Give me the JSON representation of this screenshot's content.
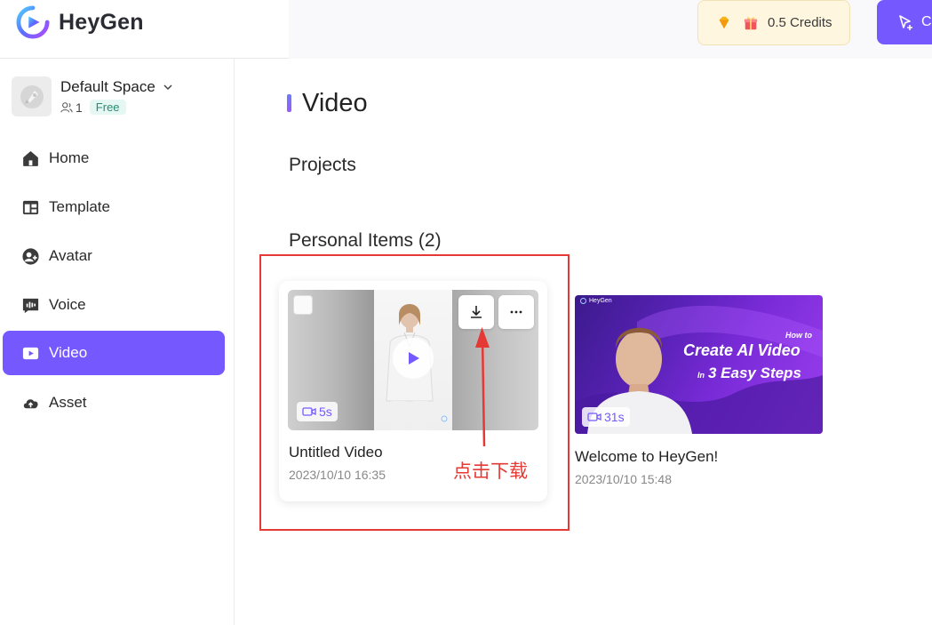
{
  "header": {
    "brand": "HeyGen",
    "credits_label": "0.5 Credits",
    "create_label": "C"
  },
  "sidebar": {
    "space": {
      "name": "Default Space",
      "members": "1",
      "plan": "Free"
    },
    "items": [
      {
        "label": "Home",
        "icon": "home-icon"
      },
      {
        "label": "Template",
        "icon": "template-icon"
      },
      {
        "label": "Avatar",
        "icon": "avatar-icon"
      },
      {
        "label": "Voice",
        "icon": "voice-icon"
      },
      {
        "label": "Video",
        "icon": "video-icon",
        "active": true
      },
      {
        "label": "Asset",
        "icon": "asset-icon"
      }
    ]
  },
  "main": {
    "title": "Video",
    "projects_label": "Projects",
    "personal_label": "Personal Items (2)",
    "videos": [
      {
        "title": "Untitled Video",
        "date": "2023/10/10 16:35",
        "duration": "5s"
      },
      {
        "title": "Welcome to HeyGen!",
        "date": "2023/10/10 15:48",
        "duration": "31s",
        "thumb_brand": "HeyGen",
        "thumb_how": "How to",
        "thumb_main": "Create AI Video",
        "thumb_in": "In",
        "thumb_steps": "3 Easy Steps"
      }
    ]
  },
  "annotation": {
    "text": "点击下载",
    "color": "#e53935"
  },
  "colors": {
    "accent": "#7559ff",
    "credits_bg": "#fff6e0",
    "free_badge": "#2a8b73"
  }
}
